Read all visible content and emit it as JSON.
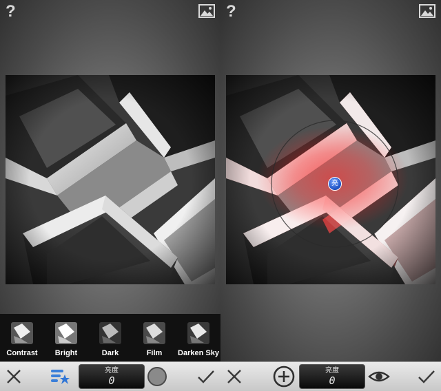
{
  "left_pane": {
    "filters": [
      {
        "label": "Contrast"
      },
      {
        "label": "Bright"
      },
      {
        "label": "Dark"
      },
      {
        "label": "Film"
      },
      {
        "label": "Darken Sky"
      }
    ]
  },
  "left_toolbar": {
    "value_label": "亮度",
    "value_number": "0"
  },
  "right_pane": {
    "control_point_label": "亮"
  },
  "right_toolbar": {
    "value_label": "亮度",
    "value_number": "0"
  },
  "colors": {
    "selection_red": "#ff1e1e",
    "control_point_blue": "#2a5fd6"
  },
  "icons": [
    "help-icon",
    "gallery-icon",
    "close-icon",
    "presets-icon",
    "circle-tool-icon",
    "confirm-icon",
    "add-point-icon",
    "eye-icon"
  ]
}
